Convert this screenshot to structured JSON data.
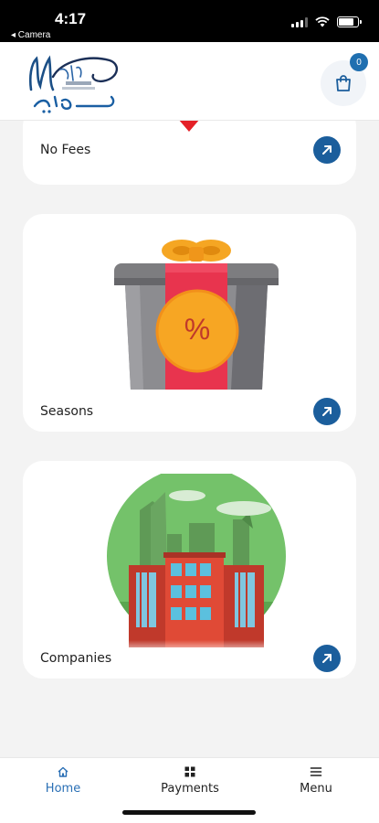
{
  "status_bar": {
    "time": "4:17",
    "back_label": "◂ Camera"
  },
  "header": {
    "logo_alt": "Marly",
    "cart_badge": "0"
  },
  "cards": [
    {
      "label": "No Fees"
    },
    {
      "label": "Seasons",
      "badge_symbol": "%"
    },
    {
      "label": "Companies"
    }
  ],
  "bottom_nav": {
    "items": [
      {
        "label": "Home",
        "icon": "home-icon",
        "active": true
      },
      {
        "label": "Payments",
        "icon": "grid-icon",
        "active": false
      },
      {
        "label": "Menu",
        "icon": "menu-icon",
        "active": false
      }
    ]
  },
  "colors": {
    "accent": "#1b5e9c",
    "nav_active": "#2a6fb5",
    "background": "#f3f3f3"
  }
}
